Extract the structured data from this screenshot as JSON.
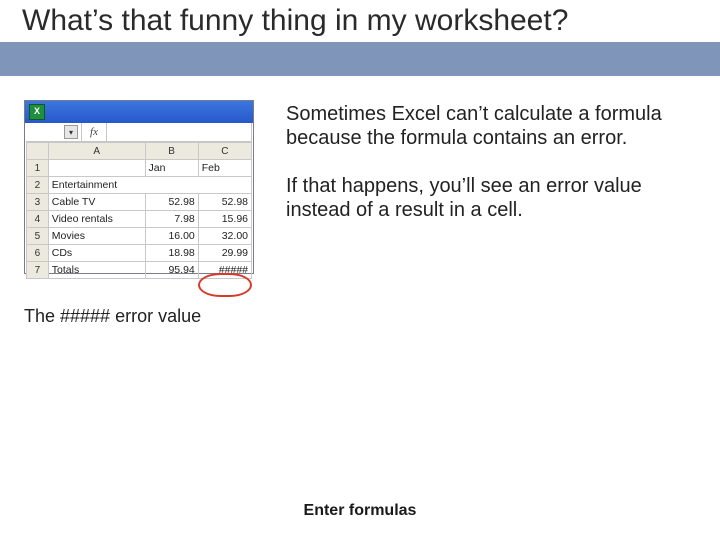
{
  "title": "What’s that funny thing in my worksheet?",
  "paragraph1": "Sometimes Excel can’t calculate a formula because the formula contains an error.",
  "paragraph2": "If that happens, you’ll see an error value instead of a result in a cell.",
  "caption": "The ##### error value",
  "footer": "Enter formulas",
  "tablecaption_ignore": "",
  "shot": {
    "icon_glyph": "X",
    "fx_label": "fx",
    "dd_glyph": "▾",
    "cols": {
      "A": "A",
      "B": "B",
      "C": "C"
    },
    "rowhdr": {
      "r1": "1",
      "r2": "2",
      "r3": "3",
      "r4": "4",
      "r5": "5",
      "r6": "6",
      "r7": "7"
    },
    "cells": {
      "A1": "",
      "B1": "Jan",
      "C1": "Feb",
      "A2": "Entertainment",
      "A3": "Cable TV",
      "B3": "52.98",
      "C3": "52.98",
      "A4": "Video rentals",
      "B4": "7.98",
      "C4": "15.96",
      "A5": "Movies",
      "B5": "16.00",
      "C5": "32.00",
      "A6": "CDs",
      "B6": "18.98",
      "C6": "29.99",
      "A7": "Totals",
      "B7": "95.94",
      "C7": "#####"
    }
  }
}
